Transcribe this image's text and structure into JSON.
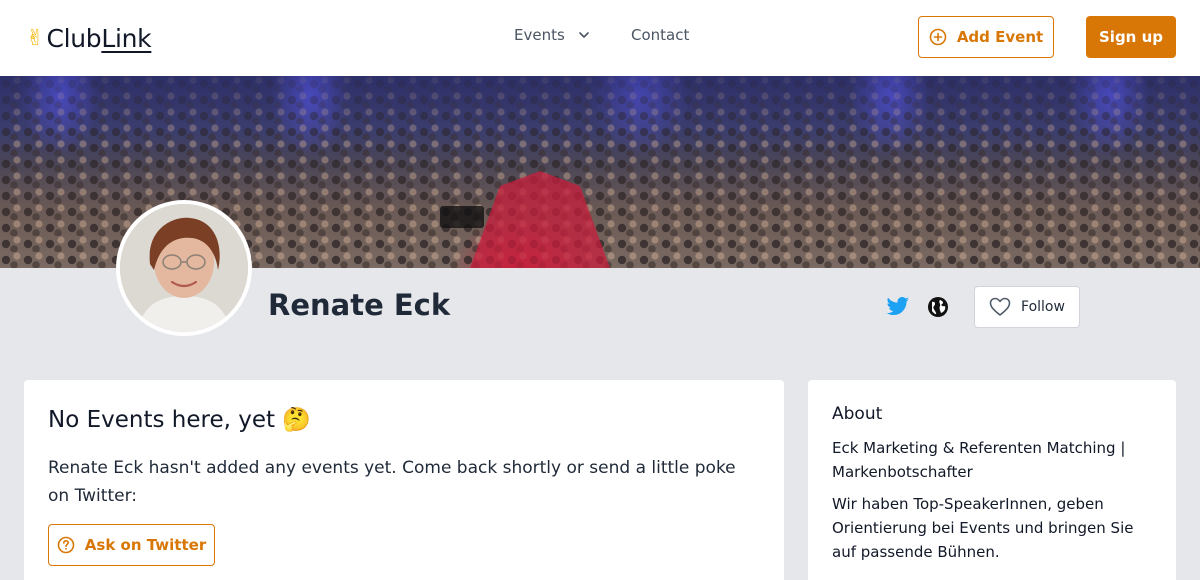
{
  "header": {
    "logo": {
      "text_prefix": "Club",
      "text_underlined": "Link",
      "hand_icon": "victory-hand-icon"
    },
    "nav": {
      "events_label": "Events",
      "contact_label": "Contact"
    },
    "add_event_label": "Add Event",
    "sign_up_label": "Sign up"
  },
  "profile": {
    "name": "Renate Eck",
    "follow_label": "Follow",
    "icons": [
      "twitter-icon",
      "globe-icon",
      "heart-icon"
    ]
  },
  "events_card": {
    "title": "No Events here, yet 🤔",
    "message": "Renate Eck hasn't added any events yet. Come back shortly or send a little poke on Twitter:",
    "ask_label": "Ask on Twitter"
  },
  "about_card": {
    "title": "About",
    "line1": "Eck Marketing & Referenten Matching | Markenbotschafter",
    "line2": "Wir haben Top-SpeakerInnen, geben Orientierung bei Events und bringen Sie auf passende Bühnen."
  },
  "colors": {
    "accent": "#d97706",
    "twitter": "#1da1f2",
    "background": "#e5e7eb"
  }
}
